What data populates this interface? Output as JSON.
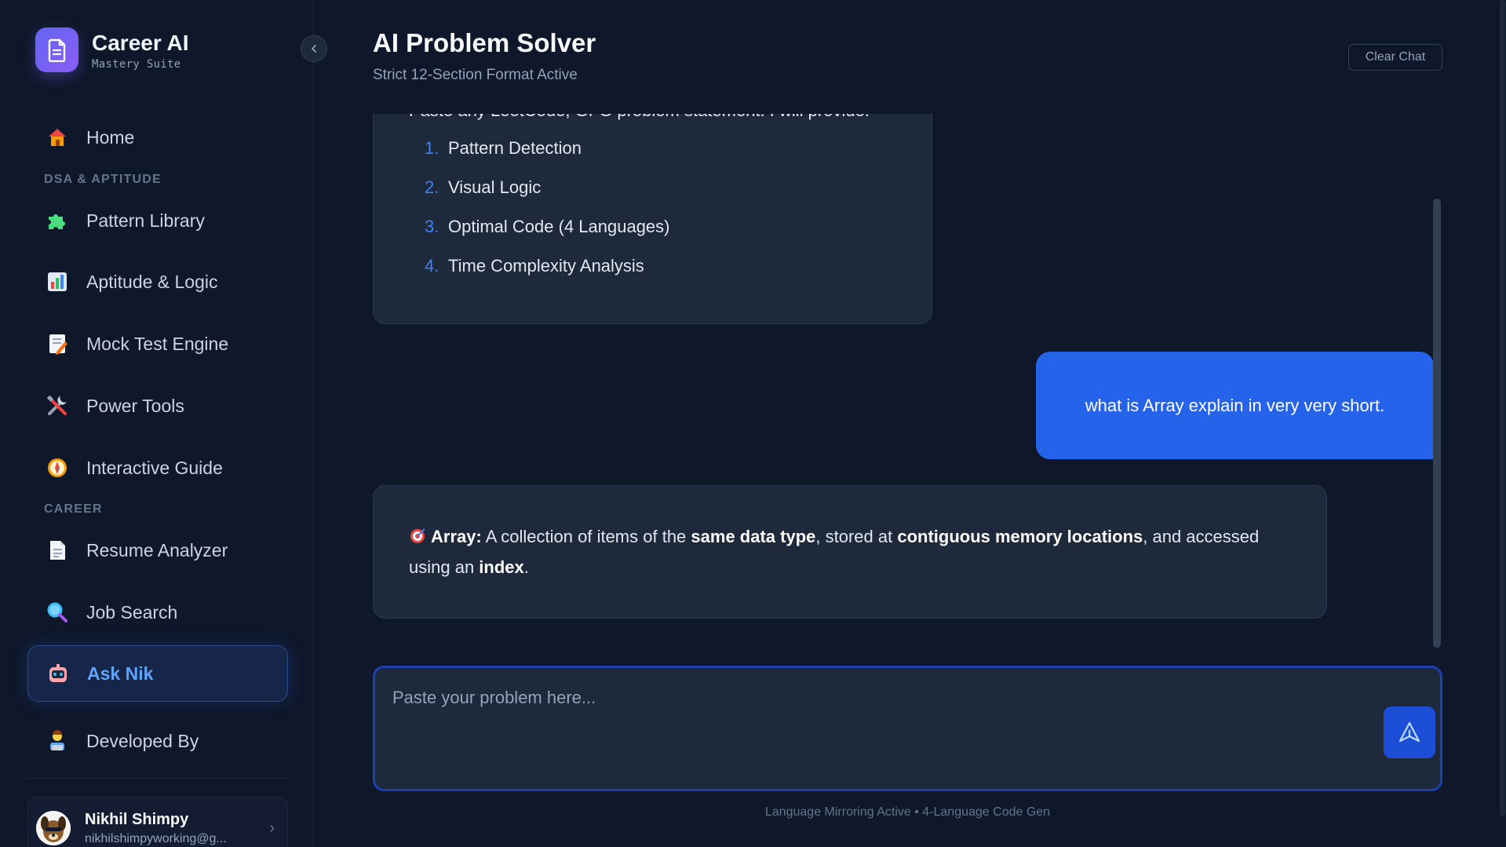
{
  "brand": {
    "title": "Career AI",
    "subtitle": "Mastery Suite"
  },
  "sidebar": {
    "items": [
      {
        "label": "Home",
        "icon": "house-icon"
      },
      {
        "label": "Pattern Library",
        "icon": "puzzle-icon"
      },
      {
        "label": "Aptitude & Logic",
        "icon": "bar-chart-icon"
      },
      {
        "label": "Mock Test Engine",
        "icon": "memo-icon"
      },
      {
        "label": "Power Tools",
        "icon": "tools-icon"
      },
      {
        "label": "Interactive Guide",
        "icon": "compass-icon"
      },
      {
        "label": "Resume Analyzer",
        "icon": "document-icon"
      },
      {
        "label": "Job Search",
        "icon": "magnifier-icon"
      },
      {
        "label": "Ask Nik",
        "icon": "robot-icon",
        "active": true
      },
      {
        "label": "Developed By",
        "icon": "technologist-icon"
      }
    ],
    "sections": {
      "dsa": "DSA & APTITUDE",
      "career": "CAREER"
    }
  },
  "profile": {
    "name": "Nikhil Shimpy",
    "email": "nikhilshimpyworking@g..."
  },
  "header": {
    "title": "AI Problem Solver",
    "subtitle": "Strict 12-Section Format Active",
    "clear_label": "Clear Chat"
  },
  "chat": {
    "intro_text": "Paste any LeetCode, GFG problem statement. I will provide:",
    "steps": [
      {
        "num": "1.",
        "text": "Pattern Detection"
      },
      {
        "num": "2.",
        "text": "Visual Logic"
      },
      {
        "num": "3.",
        "text": "Optimal Code (4 Languages)"
      },
      {
        "num": "4.",
        "text": "Time Complexity Analysis"
      }
    ],
    "user_message": "what is Array explain in very very short.",
    "answer": {
      "term": "Array:",
      "p1": " A collection of items of the ",
      "b1": "same data type",
      "p2": ", stored at ",
      "b2": "contiguous memory locations",
      "p3": ", and accessed using an ",
      "b3": "index",
      "p4": "."
    }
  },
  "composer": {
    "placeholder": "Paste your problem here..."
  },
  "footer": {
    "note": "Language Mirroring Active • 4-Language Code Gen"
  },
  "colors": {
    "accent": "#2563eb",
    "active_text": "#60a5fa",
    "background": "#0f172a",
    "card": "#1e293b"
  }
}
